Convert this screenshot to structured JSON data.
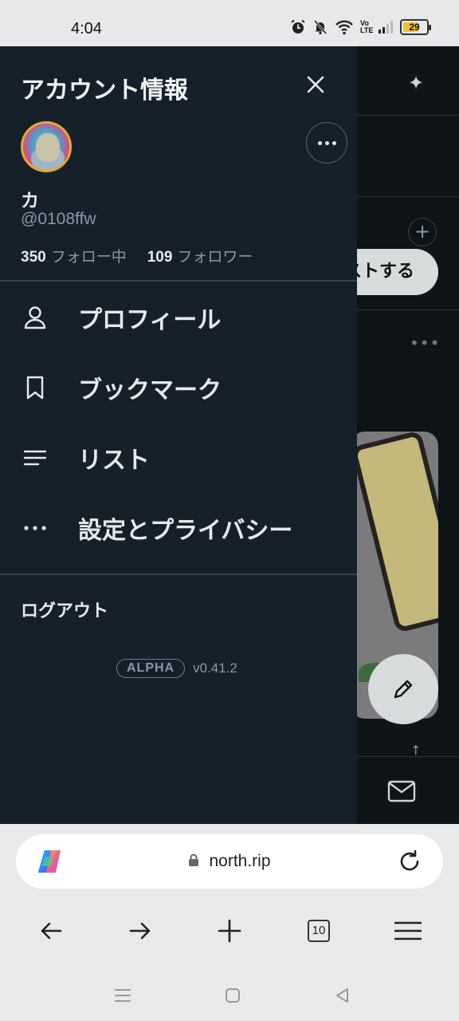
{
  "status_bar": {
    "time": "4:04",
    "icons": [
      "alarm-icon",
      "notifications-muted-icon",
      "wifi-icon",
      "volte-icon",
      "signal-icon",
      "battery-icon"
    ],
    "volte_label": "Vo LTE",
    "battery_level": "29"
  },
  "background_app": {
    "post_button_label": "ストする",
    "theme_color": "#0f1419"
  },
  "drawer": {
    "title": "アカウント情報",
    "profile": {
      "display_name": "カ",
      "handle": "@0108ffw",
      "following_count": "350",
      "following_label": "フォロー中",
      "followers_count": "109",
      "followers_label": "フォロワー"
    },
    "menu": [
      {
        "label": "プロフィール",
        "icon": "person-icon"
      },
      {
        "label": "ブックマーク",
        "icon": "bookmark-icon"
      },
      {
        "label": "リスト",
        "icon": "list-icon"
      },
      {
        "label": "設定とプライバシー",
        "icon": "more-horizontal-icon"
      }
    ],
    "logout_label": "ログアウト",
    "badge": "ALPHA",
    "version": "v0.41.2",
    "bg_color": "#15202b"
  },
  "browser": {
    "url": "north.rip",
    "tab_count": "10",
    "nav": [
      "back-icon",
      "forward-icon",
      "new-tab-icon",
      "tabs-icon",
      "menu-icon"
    ]
  },
  "system_nav": [
    "recents-icon",
    "home-icon",
    "back-triangle-icon"
  ]
}
